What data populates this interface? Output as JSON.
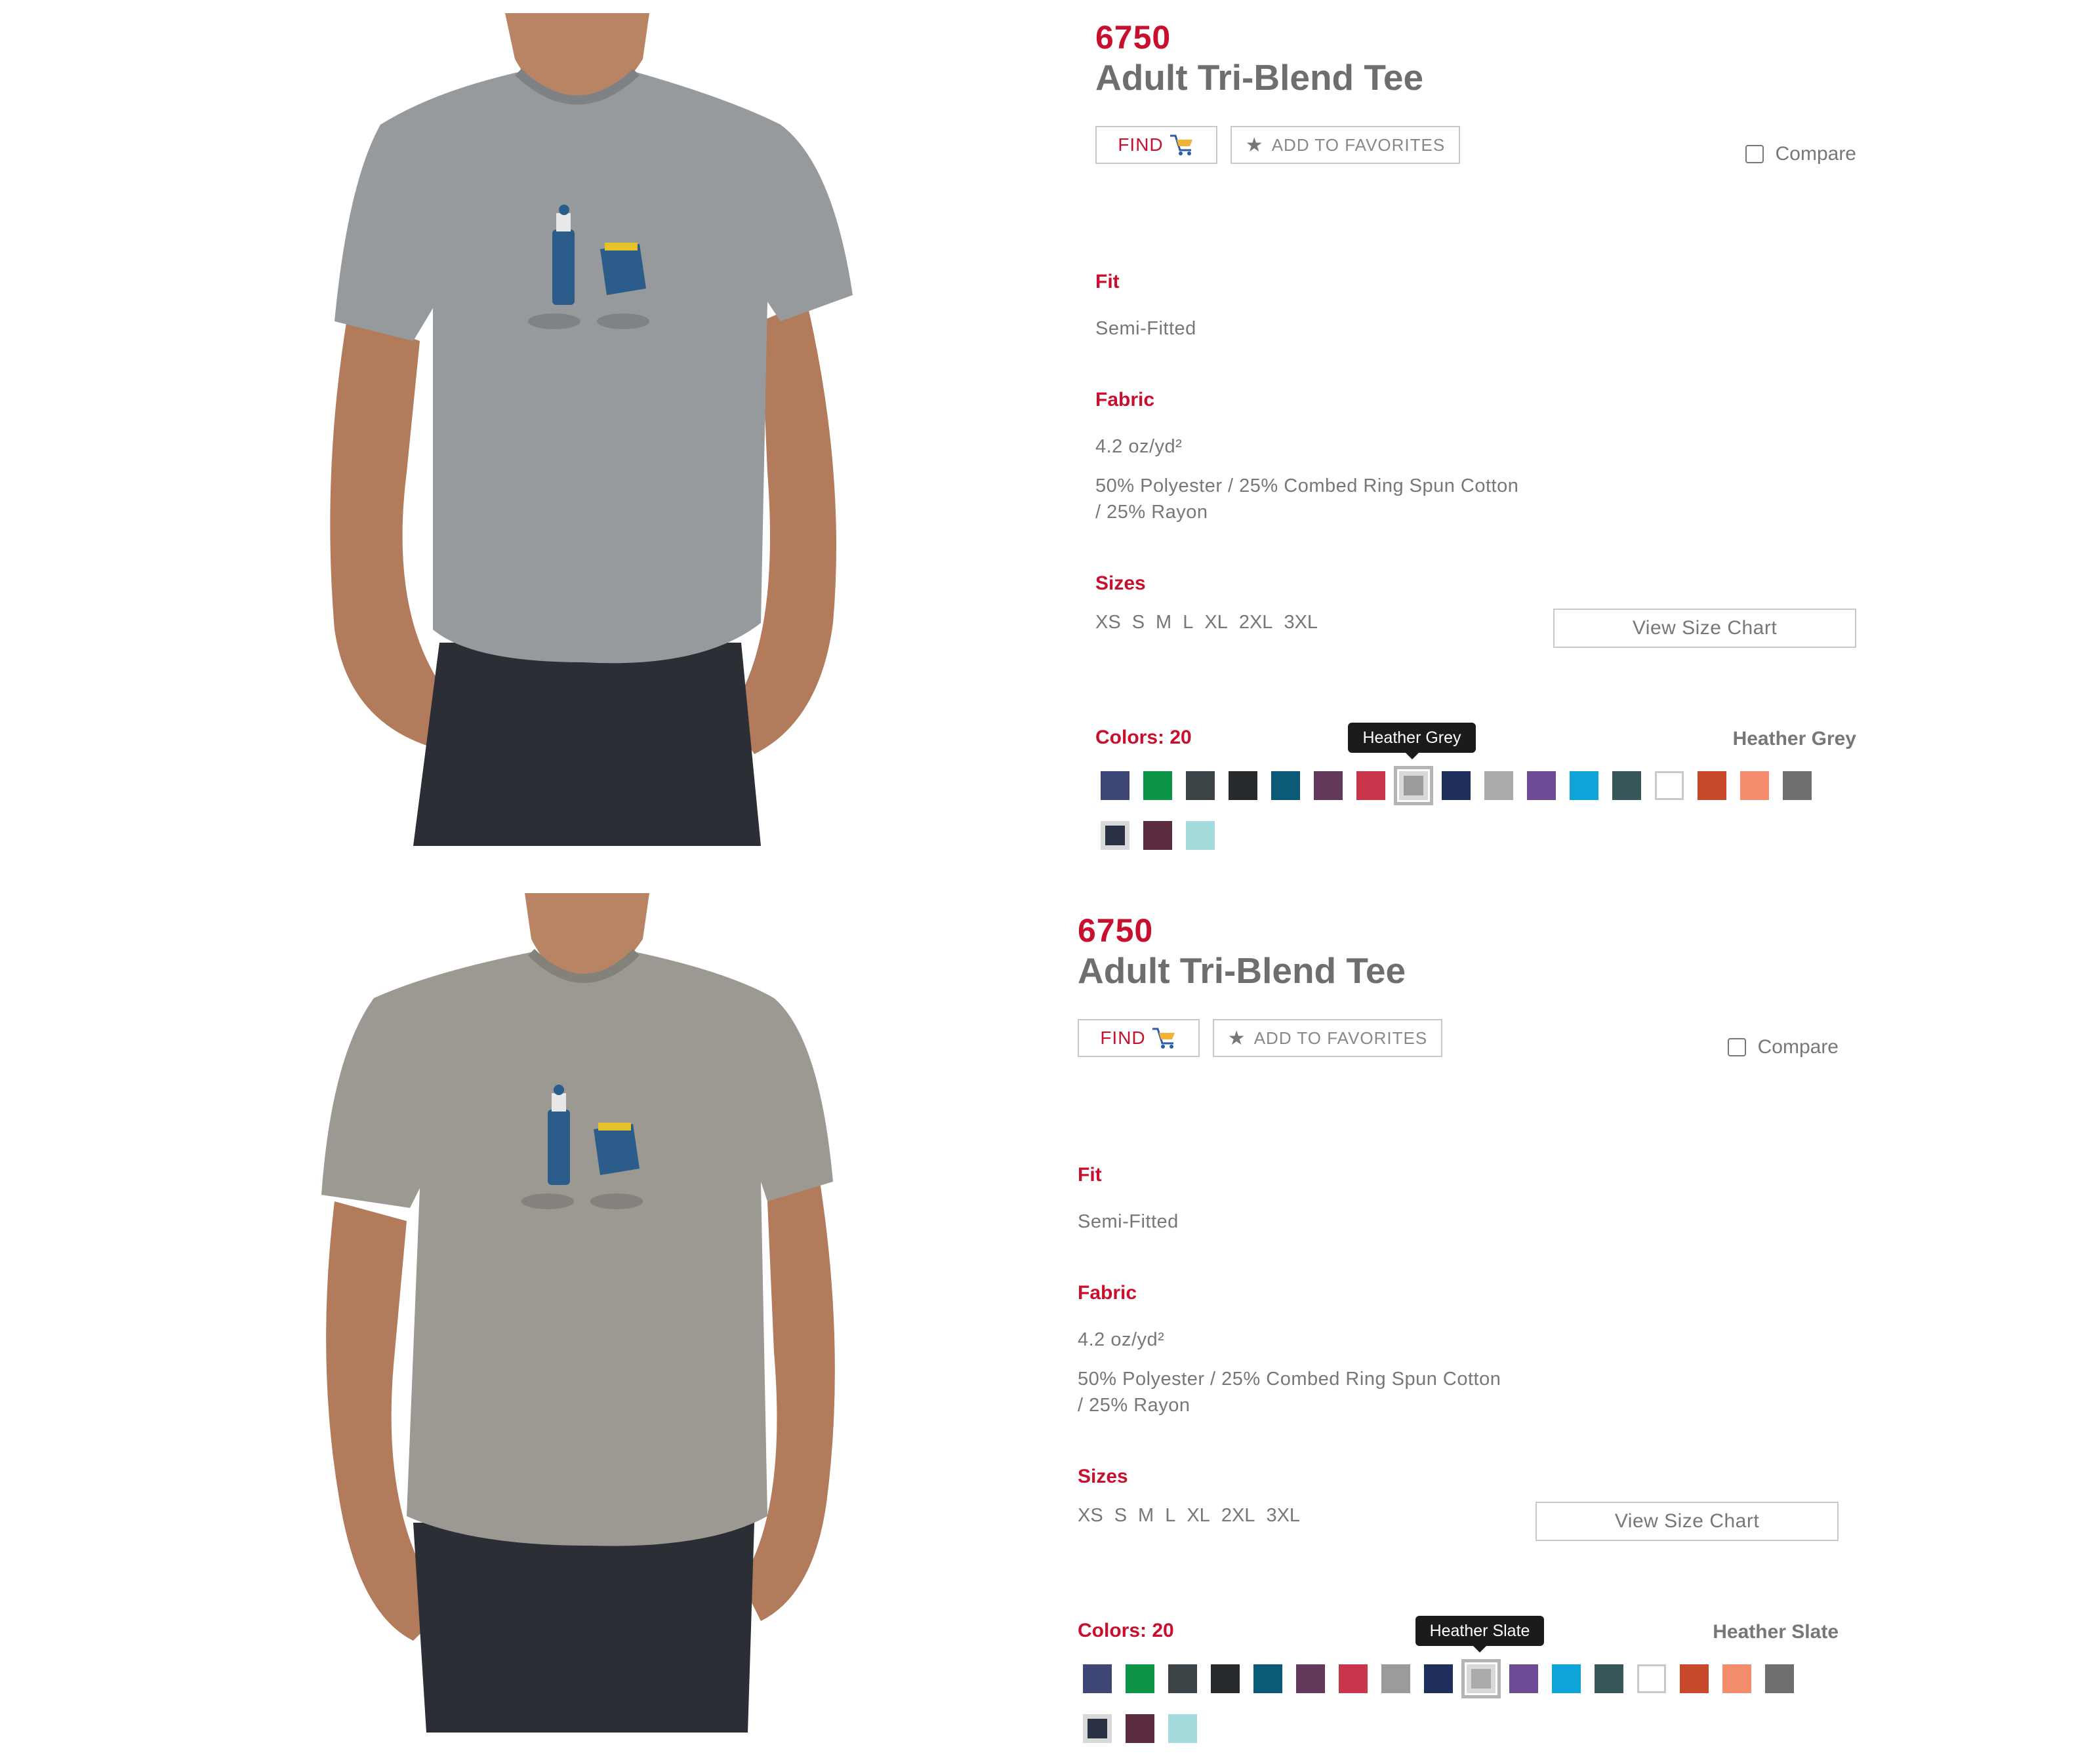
{
  "products": [
    {
      "style_number": "6750",
      "title": "Adult Tri-Blend Tee",
      "find_label": "FIND",
      "favorites_label": "ADD TO FAVORITES",
      "compare_label": "Compare",
      "fit_label": "Fit",
      "fit_value": "Semi-Fitted",
      "fabric_label": "Fabric",
      "fabric_weight": "4.2 oz/yd²",
      "fabric_line1": "50% Polyester / 25% Combed Ring Spun Cotton",
      "fabric_line2": "/ 25% Rayon",
      "sizes_label": "Sizes",
      "sizes": [
        "XS",
        "S",
        "M",
        "L",
        "XL",
        "2XL",
        "3XL"
      ],
      "size_chart_label": "View Size Chart",
      "colors_label": "Colors: 20",
      "selected_color_name": "Heather Grey",
      "tooltip": "Heather Grey",
      "shirt_color": "#979a9c",
      "swatches": [
        "#3d4675",
        "#0d9447",
        "#3c4448",
        "#262a2c",
        "#0b5a78",
        "#63385a",
        "#c8364b",
        "#9b9b9b",
        "#1e2f5c",
        "#aaaaaa",
        "#6f4a94",
        "#10a3d8",
        "#37575a",
        "#ffffff",
        "#c7492a",
        "#f48c6d",
        "#6e6f70",
        "#2b3145",
        "#5b2b40",
        "#a5dbdc"
      ],
      "selected_swatch": 7
    },
    {
      "style_number": "6750",
      "title": "Adult Tri-Blend Tee",
      "find_label": "FIND",
      "favorites_label": "ADD TO FAVORITES",
      "compare_label": "Compare",
      "fit_label": "Fit",
      "fit_value": "Semi-Fitted",
      "fabric_label": "Fabric",
      "fabric_weight": "4.2 oz/yd²",
      "fabric_line1": "50% Polyester / 25% Combed Ring Spun Cotton",
      "fabric_line2": "/ 25% Rayon",
      "sizes_label": "Sizes",
      "sizes": [
        "XS",
        "S",
        "M",
        "L",
        "XL",
        "2XL",
        "3XL"
      ],
      "size_chart_label": "View Size Chart",
      "colors_label": "Colors: 20",
      "selected_color_name": "Heather Slate",
      "tooltip": "Heather Slate",
      "shirt_color": "#9c9993",
      "swatches": [
        "#3d4675",
        "#0d9447",
        "#3c4448",
        "#262a2c",
        "#0b5a78",
        "#63385a",
        "#c8364b",
        "#9b9b9b",
        "#1e2f5c",
        "#aaaaaa",
        "#6f4a94",
        "#10a3d8",
        "#37575a",
        "#ffffff",
        "#c7492a",
        "#f48c6d",
        "#6e6f70",
        "#2b3145",
        "#5b2b40",
        "#a5dbdc"
      ],
      "selected_swatch": 9
    }
  ],
  "colors": {
    "accent": "#c8102e",
    "text_grey": "#777777",
    "border": "#c9c9c9"
  }
}
